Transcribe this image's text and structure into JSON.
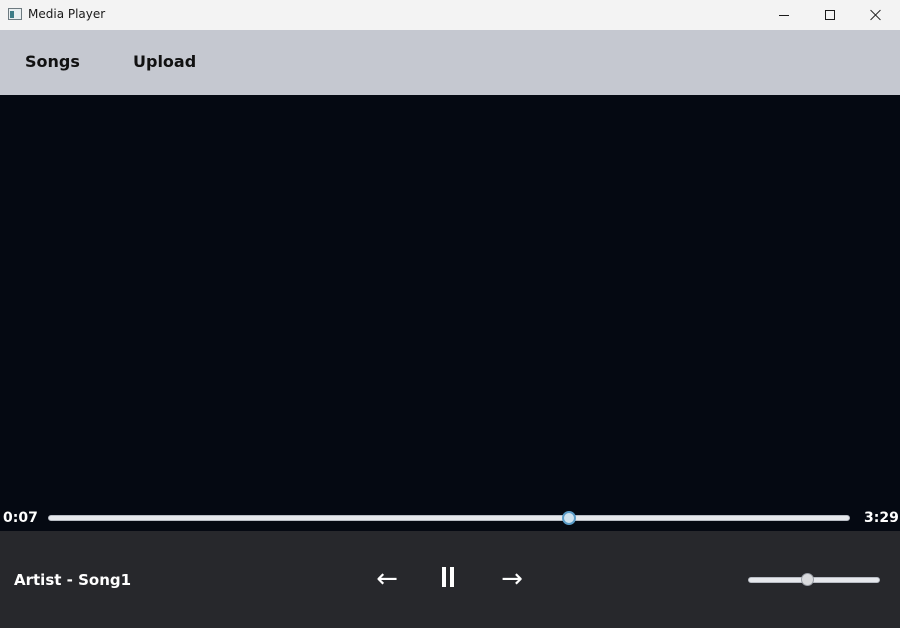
{
  "window": {
    "title": "Media Player",
    "icon": "media-player-app-icon",
    "controls": [
      "minimize-icon",
      "maximize-icon",
      "close-icon"
    ]
  },
  "nav": {
    "items": [
      {
        "label": "Songs"
      },
      {
        "label": "Upload"
      }
    ]
  },
  "playback": {
    "current_time": "0:07",
    "total_time": "3:29",
    "progress_fraction": 0.65,
    "now_playing": "Artist - Song1",
    "prev_glyph": "←",
    "next_glyph": "→",
    "play_state": "pause-icon",
    "volume_fraction": 0.45
  },
  "colors": {
    "titlebar_bg": "#f3f3f3",
    "navbar_bg": "#c5c8d0",
    "video_bg": "#050912",
    "controlbar_bg": "#27282c",
    "thumb_accent": "#5a9bc7"
  }
}
